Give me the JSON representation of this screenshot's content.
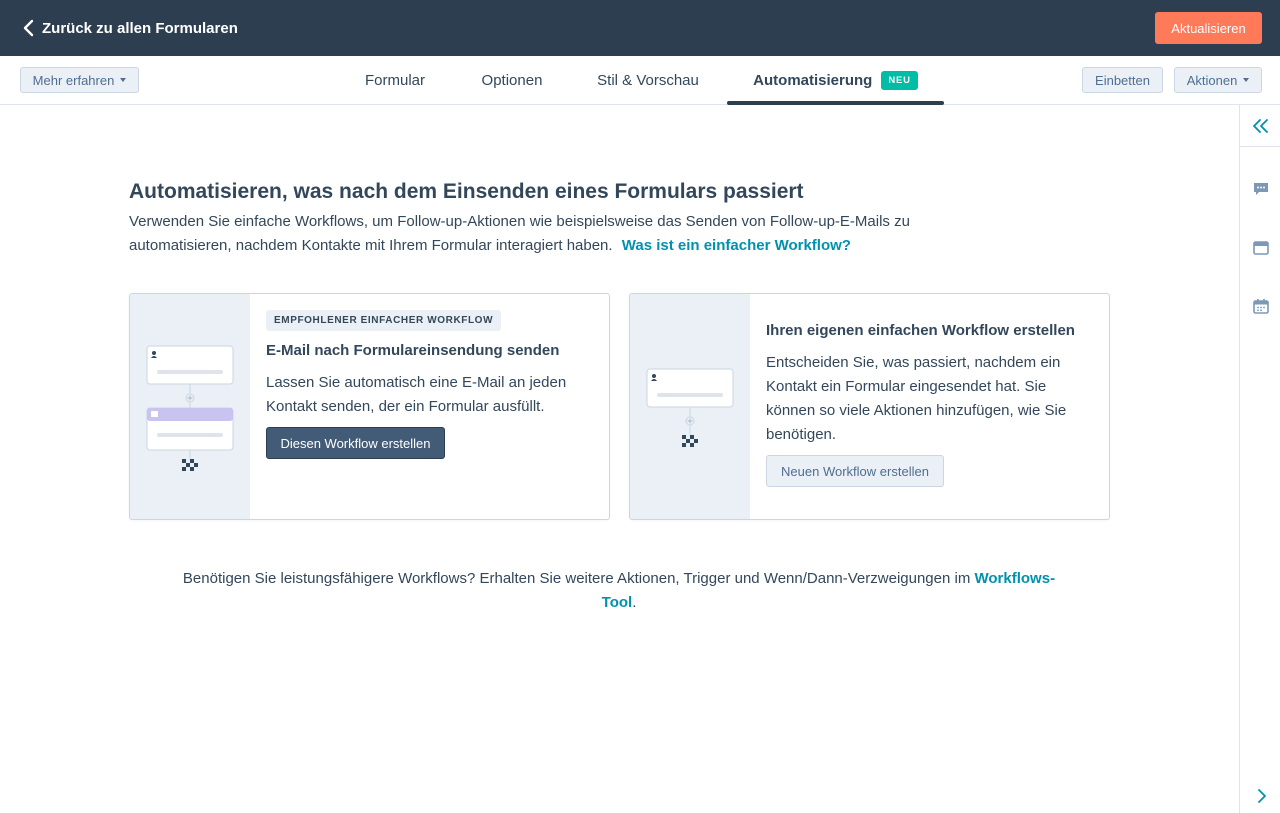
{
  "topbar": {
    "back_label": "Zurück zu allen Formularen",
    "update_button": "Aktualisieren",
    "bg_color": "#2d3e50",
    "accent_color": "#ff7a59"
  },
  "tabbar": {
    "learn_more": "Mehr erfahren",
    "tabs": [
      {
        "label": "Formular"
      },
      {
        "label": "Optionen"
      },
      {
        "label": "Stil & Vorschau"
      },
      {
        "label": "Automatisierung",
        "active": true,
        "badge": "NEU"
      }
    ],
    "embed": "Einbetten",
    "actions": "Aktionen"
  },
  "sidebar": {
    "icons": [
      "collapse-double-chevron-icon",
      "chat-icon",
      "window-icon",
      "calendar-icon",
      "chevron-right-icon"
    ]
  },
  "main": {
    "heading": "Automatisieren, was nach dem Einsenden eines Formulars passiert",
    "intro": "Verwenden Sie einfache Workflows, um Follow-up-Aktionen wie beispielsweise das Senden von Follow-up-E-Mails zu automatisieren, nachdem Kontakte mit Ihrem Formular interagiert haben.",
    "intro_link": "Was ist ein einfacher Workflow?",
    "cards": [
      {
        "tag": "EMPFOHLENER EINFACHER WORKFLOW",
        "title": "E-Mail nach Formulareinsendung senden",
        "text": "Lassen Sie automatisch eine E-Mail an jeden Kontakt senden, der ein Formular ausfüllt.",
        "button": "Diesen Workflow erstellen"
      },
      {
        "title": "Ihren eigenen einfachen Workflow erstellen",
        "text": "Entscheiden Sie, was passiert, nachdem ein Kontakt ein Formular eingesendet hat. Sie können so viele Aktionen hinzufügen, wie Sie benötigen.",
        "button": "Neuen Workflow erstellen"
      }
    ],
    "footer_text": "Benötigen Sie leistungsfähigere Workflows? Erhalten Sie weitere Aktionen, Trigger und Wenn/Dann-Verzweigungen im ",
    "footer_link": "Workflows-Tool",
    "footer_end": ".",
    "link_color": "#0091ae",
    "badge_color": "#00bda5"
  }
}
